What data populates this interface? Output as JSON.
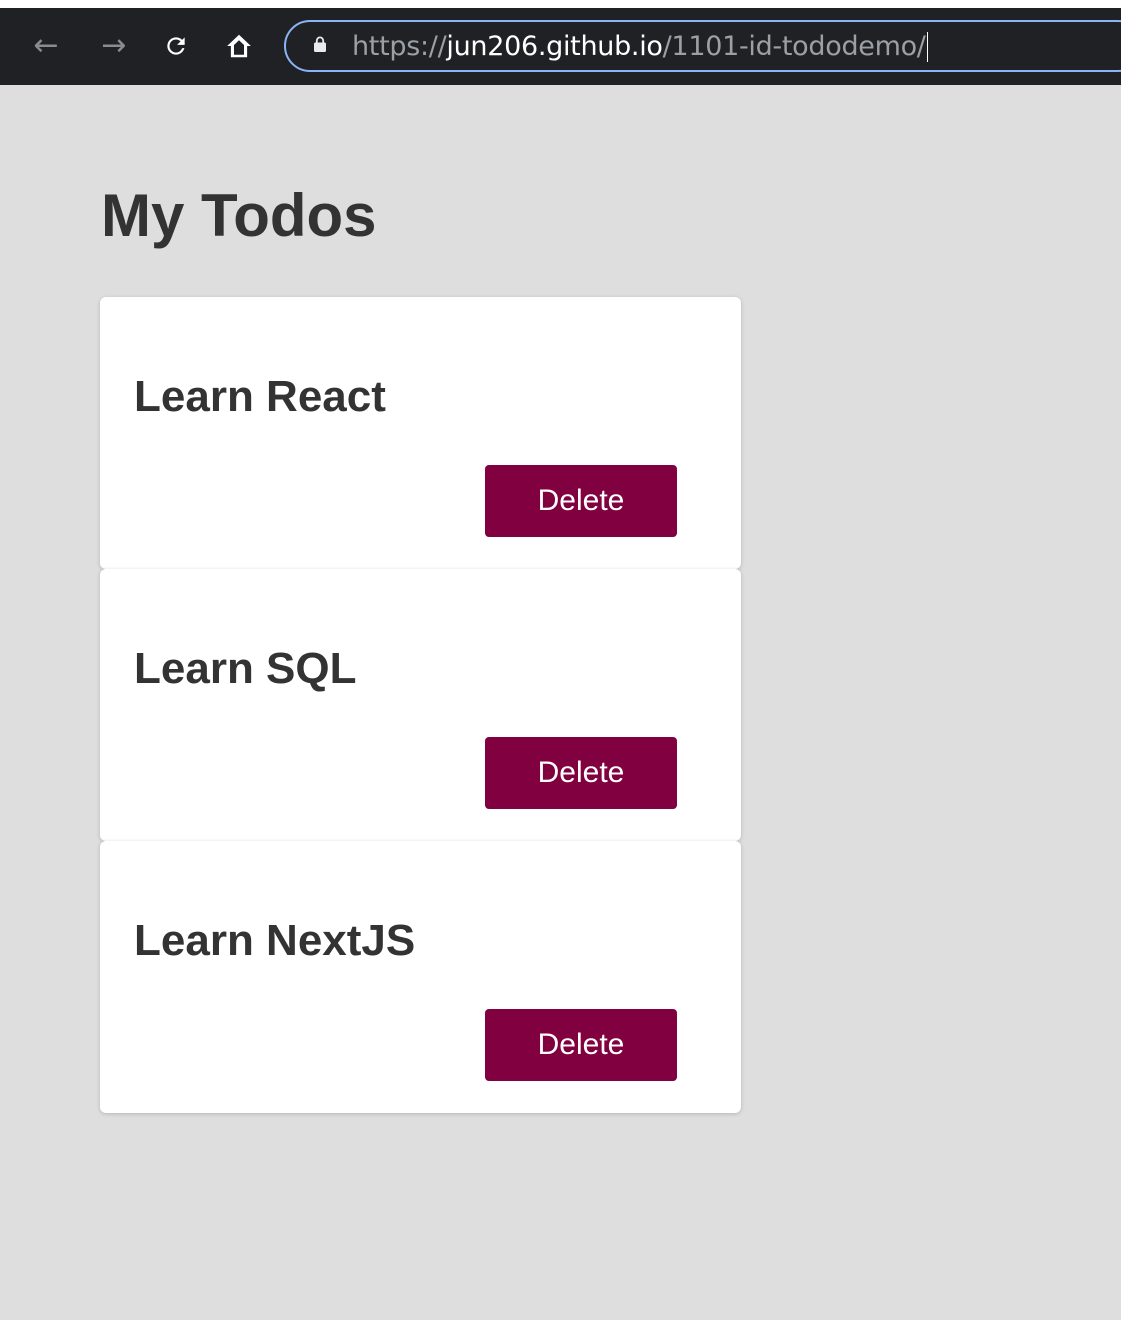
{
  "browser": {
    "url_scheme": "https://",
    "url_host": "jun206.github.io",
    "url_path": "/1101-id-tododemo/",
    "icons": {
      "back": "arrow-left-icon",
      "forward": "arrow-right-icon",
      "reload": "reload-icon",
      "home": "home-icon",
      "lock": "lock-icon"
    },
    "accent_color": "#8ab4f8"
  },
  "page": {
    "title": "My Todos"
  },
  "todos": [
    {
      "text": "Learn React",
      "delete_label": "Delete"
    },
    {
      "text": "Learn SQL",
      "delete_label": "Delete"
    },
    {
      "text": "Learn NextJS",
      "delete_label": "Delete"
    }
  ],
  "colors": {
    "background": "#dedede",
    "card": "#ffffff",
    "delete_button": "#800040",
    "text": "#333333"
  }
}
